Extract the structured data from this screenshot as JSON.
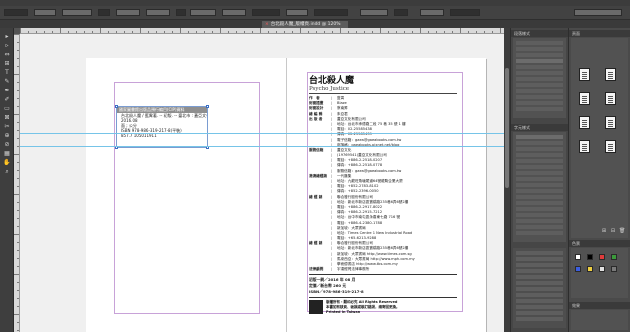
{
  "control_bar": {
    "x_value": "",
    "zoom": ""
  },
  "tab": {
    "title": "台北殺人魔_版權頁.indd @ 120%",
    "close": "×"
  },
  "tools": [
    "▸",
    "▹",
    "⇔",
    "⊞",
    "T",
    "✎",
    "✒",
    "✐",
    "▭",
    "⊠",
    "✂",
    "⊕",
    "⊘",
    "▦",
    "✋",
    "⌕"
  ],
  "cip": {
    "header": "國家圖書館出版品預行編目(CIP)資料",
    "lines": [
      "台北殺人魔 / 藍霄著. -- 初版. -- 臺北市 : 蓋亞文化,",
      "2016.08",
      "面 ; 公分",
      "ISBN 978-986-319-217-8(平裝)",
      "",
      "857.7            105011911"
    ]
  },
  "credits": {
    "title": "台北殺人魔",
    "subtitle": "Psycho Justice",
    "rows": [
      {
        "label": "作　者",
        "value": "藍霄"
      },
      {
        "label": "封面插畫",
        "value": "Blaze"
      },
      {
        "label": "封面設計",
        "value": "蔡南昇"
      },
      {
        "label": "總 編 輯",
        "value": "朱亞君"
      },
      {
        "label": "出 版 者",
        "value": "蓋亞文化有限公司"
      },
      {
        "label": "",
        "value": "地址：台北市承德路二段 75 巷 35 號 1 樓"
      },
      {
        "label": "",
        "value": "電話：02-25585438"
      },
      {
        "label": "",
        "value": "傳真：02-25585439"
      },
      {
        "label": "",
        "value": "電子信箱：gaea@gaeabooks.com.tw"
      },
      {
        "label": "",
        "value": "部落格：gaeabooks.pixnet.net/blog"
      },
      {
        "label": "服務信箱",
        "value": "蓋亞文化"
      },
      {
        "label": "",
        "value": "(19769541)蓋亞文化有限公司"
      },
      {
        "label": "",
        "value": "電話：+886-2-2518-0207"
      },
      {
        "label": "",
        "value": "傳真：+886-2-2518-0778"
      },
      {
        "label": "",
        "value": "服務信箱：gaea@gaeabooks.com.tw"
      },
      {
        "label": "港澳總經銷",
        "value": "一代匯集"
      },
      {
        "label": "",
        "value": "地址：九龍旺角塘尾道64號龍駒企業大廈"
      },
      {
        "label": "",
        "value": "電話：+852-2783-8102"
      },
      {
        "label": "",
        "value": "傳真：+852-2396-0050"
      },
      {
        "label": "總 經 銷",
        "value": "聯合發行股份有限公司"
      },
      {
        "label": "",
        "value": "地址：新北市新店區寶橋路235巷6弄6號2樓"
      },
      {
        "label": "",
        "value": "電話：+886-2-2917-8022"
      },
      {
        "label": "",
        "value": "傳真：+886-2-2915-7212"
      },
      {
        "label": "",
        "value": "地址：台中市南屯區永春東七路 716 號"
      },
      {
        "label": "",
        "value": "電話：+886-4-2380-1788"
      },
      {
        "label": "",
        "value": "新加坡：大眾書局"
      },
      {
        "label": "",
        "value": "地址：Times Centre 1 New Industrial Road"
      },
      {
        "label": "",
        "value": "電話：+65-6213-9288"
      },
      {
        "label": "總 經 銷",
        "value": "聯合發行股份有限公司"
      },
      {
        "label": "",
        "value": "地址：新北市新店區寶橋路235巷6弄6號2樓"
      },
      {
        "label": "",
        "value": "新加坡：大眾書局 http://www.times.com.sg"
      },
      {
        "label": "",
        "value": "馬來西亞：大眾書局 http://www.mph.com.my"
      },
      {
        "label": "",
        "value": "學而優書店 http://www.tbs.com.my"
      },
      {
        "label": "法律顧問",
        "value": "宇達經貿法律事務所"
      }
    ],
    "pub": [
      "初版一刷／2016 年 08 月",
      "定價／新台幣 260 元",
      "ISBN／978-986-319-217-8"
    ],
    "rights": [
      "版權所有・翻印必究  All Rights Reserved",
      "本書如有缺頁、破損或裝訂錯誤，請寄回更換。",
      "Printed in Taiwan"
    ]
  },
  "panels": {
    "left_head": "段落樣式",
    "left_head2": "字元樣式",
    "right_head": "頁面",
    "right_head2": "色票",
    "right_head3": "效果"
  }
}
